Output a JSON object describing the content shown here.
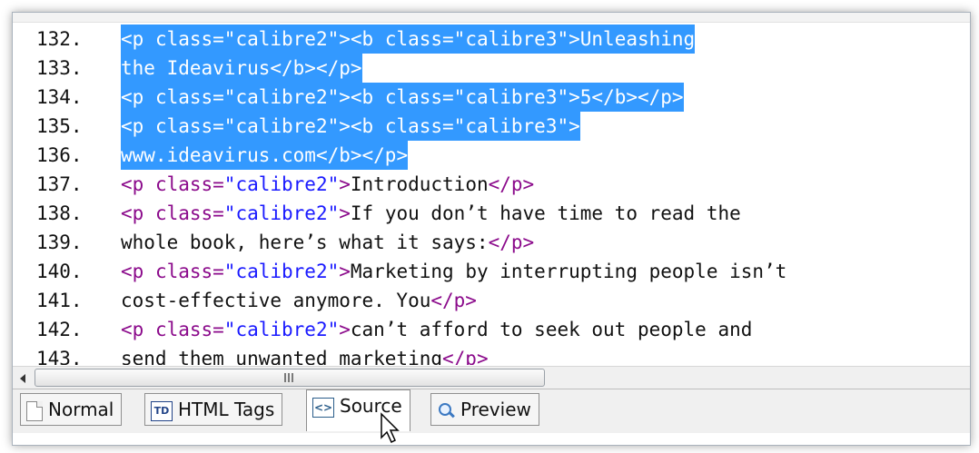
{
  "editor": {
    "lines": [
      {
        "n": "132.",
        "selected": true,
        "tokens": [
          {
            "t": "tag",
            "v": "<p "
          },
          {
            "t": "attr",
            "v": "class="
          },
          {
            "t": "val",
            "v": "\"calibre2\""
          },
          {
            "t": "tag",
            "v": "><b "
          },
          {
            "t": "attr",
            "v": "class="
          },
          {
            "t": "val",
            "v": "\"calibre3\""
          },
          {
            "t": "tag",
            "v": ">"
          },
          {
            "t": "txt",
            "v": "Unleashing"
          }
        ]
      },
      {
        "n": "133.",
        "selected": true,
        "tokens": [
          {
            "t": "txt",
            "v": "the Ideavirus"
          },
          {
            "t": "tag",
            "v": "</b></p>"
          }
        ]
      },
      {
        "n": "134.",
        "selected": true,
        "tokens": [
          {
            "t": "tag",
            "v": "<p "
          },
          {
            "t": "attr",
            "v": "class="
          },
          {
            "t": "val",
            "v": "\"calibre2\""
          },
          {
            "t": "tag",
            "v": "><b "
          },
          {
            "t": "attr",
            "v": "class="
          },
          {
            "t": "val",
            "v": "\"calibre3\""
          },
          {
            "t": "tag",
            "v": ">"
          },
          {
            "t": "txt",
            "v": "5"
          },
          {
            "t": "tag",
            "v": "</b></p>"
          }
        ]
      },
      {
        "n": "135.",
        "selected": true,
        "tokens": [
          {
            "t": "tag",
            "v": "<p "
          },
          {
            "t": "attr",
            "v": "class="
          },
          {
            "t": "val",
            "v": "\"calibre2\""
          },
          {
            "t": "tag",
            "v": "><b "
          },
          {
            "t": "attr",
            "v": "class="
          },
          {
            "t": "val",
            "v": "\"calibre3\""
          },
          {
            "t": "tag",
            "v": ">"
          }
        ]
      },
      {
        "n": "136.",
        "selected": true,
        "tokens": [
          {
            "t": "txt",
            "v": "www.ideavirus.com"
          },
          {
            "t": "tag",
            "v": "</b></p>"
          }
        ]
      },
      {
        "n": "137.",
        "selected": false,
        "tokens": [
          {
            "t": "tag",
            "v": "<p "
          },
          {
            "t": "attr",
            "v": "class="
          },
          {
            "t": "val",
            "v": "\"calibre2\""
          },
          {
            "t": "tag",
            "v": ">"
          },
          {
            "t": "txt",
            "v": "Introduction"
          },
          {
            "t": "tag",
            "v": "</p>"
          }
        ]
      },
      {
        "n": "138.",
        "selected": false,
        "tokens": [
          {
            "t": "tag",
            "v": "<p "
          },
          {
            "t": "attr",
            "v": "class="
          },
          {
            "t": "val",
            "v": "\"calibre2\""
          },
          {
            "t": "tag",
            "v": ">"
          },
          {
            "t": "txt",
            "v": "If you don’t have time to read the"
          }
        ]
      },
      {
        "n": "139.",
        "selected": false,
        "tokens": [
          {
            "t": "txt",
            "v": "whole book, here’s what it says:"
          },
          {
            "t": "tag",
            "v": "</p>"
          }
        ]
      },
      {
        "n": "140.",
        "selected": false,
        "tokens": [
          {
            "t": "tag",
            "v": "<p "
          },
          {
            "t": "attr",
            "v": "class="
          },
          {
            "t": "val",
            "v": "\"calibre2\""
          },
          {
            "t": "tag",
            "v": ">"
          },
          {
            "t": "txt",
            "v": "Marketing by interrupting people isn’t"
          }
        ]
      },
      {
        "n": "141.",
        "selected": false,
        "tokens": [
          {
            "t": "txt",
            "v": "cost-effective anymore. You"
          },
          {
            "t": "tag",
            "v": "</p>"
          }
        ]
      },
      {
        "n": "142.",
        "selected": false,
        "tokens": [
          {
            "t": "tag",
            "v": "<p "
          },
          {
            "t": "attr",
            "v": "class="
          },
          {
            "t": "val",
            "v": "\"calibre2\""
          },
          {
            "t": "tag",
            "v": ">"
          },
          {
            "t": "txt",
            "v": "can’t afford to seek out people and"
          }
        ]
      },
      {
        "n": "143.",
        "selected": false,
        "tokens": [
          {
            "t": "txt",
            "v": "send them unwanted marketing"
          },
          {
            "t": "tag",
            "v": "</p>"
          }
        ]
      }
    ]
  },
  "scrollbar": {
    "grip_label": "III"
  },
  "tabs": [
    {
      "label": "Normal",
      "icon": "page-icon",
      "active": false
    },
    {
      "label": "HTML Tags",
      "icon": "td-icon",
      "active": false
    },
    {
      "label": "Source",
      "icon": "source-code-icon",
      "active": true
    },
    {
      "label": "Preview",
      "icon": "magnifier-icon",
      "active": false
    }
  ],
  "colors": {
    "selection": "#3399ff",
    "tag": "#8b0a8b",
    "attr_value": "#1a1aff",
    "text": "#111111"
  }
}
